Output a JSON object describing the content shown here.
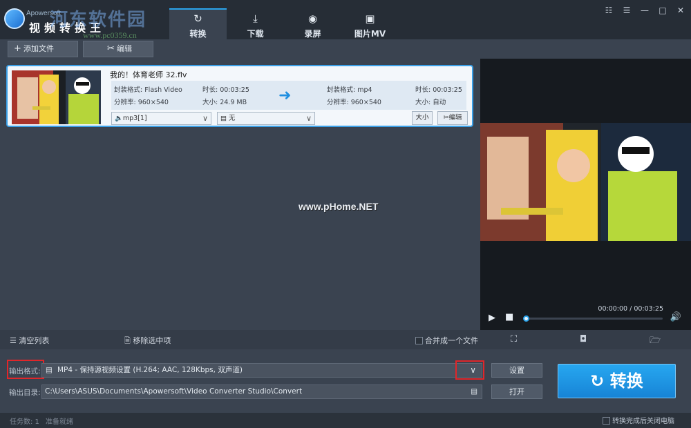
{
  "app": {
    "logo_small": "Apowersoft",
    "title": "视频转换王",
    "watermark_top": "河东软件园",
    "watermark_url": "www.pc0359.cn",
    "watermark_mid": "www.pHome.NET"
  },
  "tabs": [
    {
      "label": "转换",
      "icon": "refresh-icon"
    },
    {
      "label": "下载",
      "icon": "download-icon"
    },
    {
      "label": "录屏",
      "icon": "record-icon"
    },
    {
      "label": "图片MV",
      "icon": "tv-icon"
    }
  ],
  "toolbar": {
    "add_file": "添加文件",
    "edit": "编辑"
  },
  "file": {
    "name": "我的！体育老师 32.flv",
    "src_format": "封装格式: Flash Video",
    "src_duration": "时长: 00:03:25",
    "src_resolution": "分辨率: 960×540",
    "src_size": "大小: 24.9 MB",
    "dst_format": "封装格式: mp4",
    "dst_duration": "时长: 00:03:25",
    "dst_resolution": "分辨率: 960×540",
    "dst_size": "大小: 自动",
    "audio_track": "mp3[1]",
    "subtitle": "无",
    "size_btn": "大小",
    "edit_btn": "编辑"
  },
  "preview": {
    "time": "00:00:00 / 00:03:25",
    "progress": 0
  },
  "actions": {
    "clear": "清空列表",
    "remove": "移除选中项",
    "merge": "合并成一个文件"
  },
  "output": {
    "format_label": "输出格式:",
    "format_value": "MP4 - 保持源视频设置 (H.264; AAC, 128Kbps, 双声道)",
    "dir_label": "输出目录:",
    "dir_value": "C:\\Users\\ASUS\\Documents\\Apowersoft\\Video Converter Studio\\Convert",
    "settings_btn": "设置",
    "open_btn": "打开",
    "convert_btn": "转换"
  },
  "status": {
    "tasks": "任务数: 1",
    "ready": "准备就绪",
    "shutdown": "转换完成后关闭电脑"
  },
  "colors": {
    "accent": "#2aa4ec",
    "highlight": "#e0262a"
  }
}
